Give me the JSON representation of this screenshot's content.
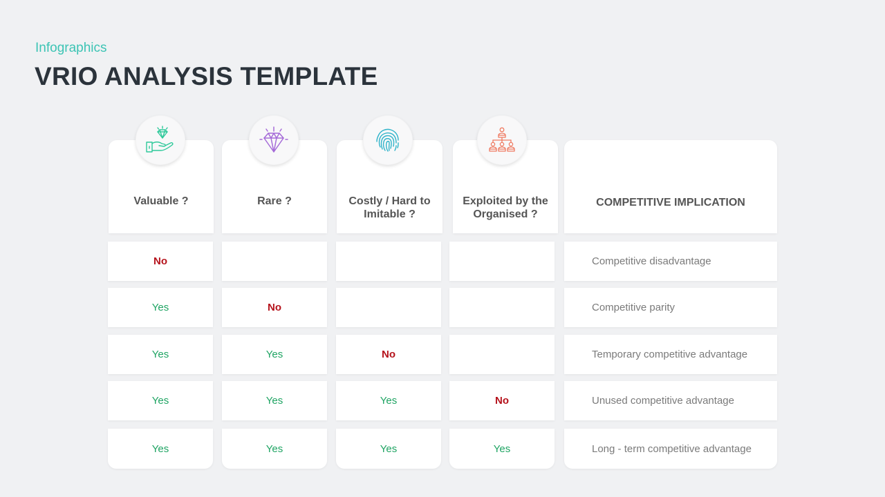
{
  "header": {
    "subtitle": "Infographics",
    "title": "VRIO ANALYSIS TEMPLATE"
  },
  "columns": [
    {
      "label": "Valuable ?",
      "icon": "hand-diamond-icon",
      "color": "#2ec99a"
    },
    {
      "label": "Rare ?",
      "icon": "diamond-icon",
      "color": "#a56bd8"
    },
    {
      "label": "Costly / Hard to Imitable ?",
      "label_line1": "Costly / Hard to",
      "label_line2": "Imitable ?",
      "icon": "fingerprint-icon",
      "color": "#2eb3c9"
    },
    {
      "label": "Exploited by the Organised ?",
      "label_line1": "Exploited by the",
      "label_line2": "Organised ?",
      "icon": "org-chart-icon",
      "color": "#ef7a61"
    },
    {
      "label": "COMPETITIVE IMPLICATION"
    }
  ],
  "rows": [
    {
      "cells": [
        "No",
        "",
        "",
        ""
      ],
      "implication": "Competitive disadvantage"
    },
    {
      "cells": [
        "Yes",
        "No",
        "",
        ""
      ],
      "implication": "Competitive parity"
    },
    {
      "cells": [
        "Yes",
        "Yes",
        "No",
        ""
      ],
      "implication": "Temporary competitive advantage"
    },
    {
      "cells": [
        "Yes",
        "Yes",
        "Yes",
        "No"
      ],
      "implication": "Unused competitive advantage"
    },
    {
      "cells": [
        "Yes",
        "Yes",
        "Yes",
        "Yes"
      ],
      "implication": "Long - term competitive advantage"
    }
  ],
  "colors": {
    "yes": "#1fa463",
    "no": "#b5121b",
    "accent": "#3cc4b4"
  }
}
